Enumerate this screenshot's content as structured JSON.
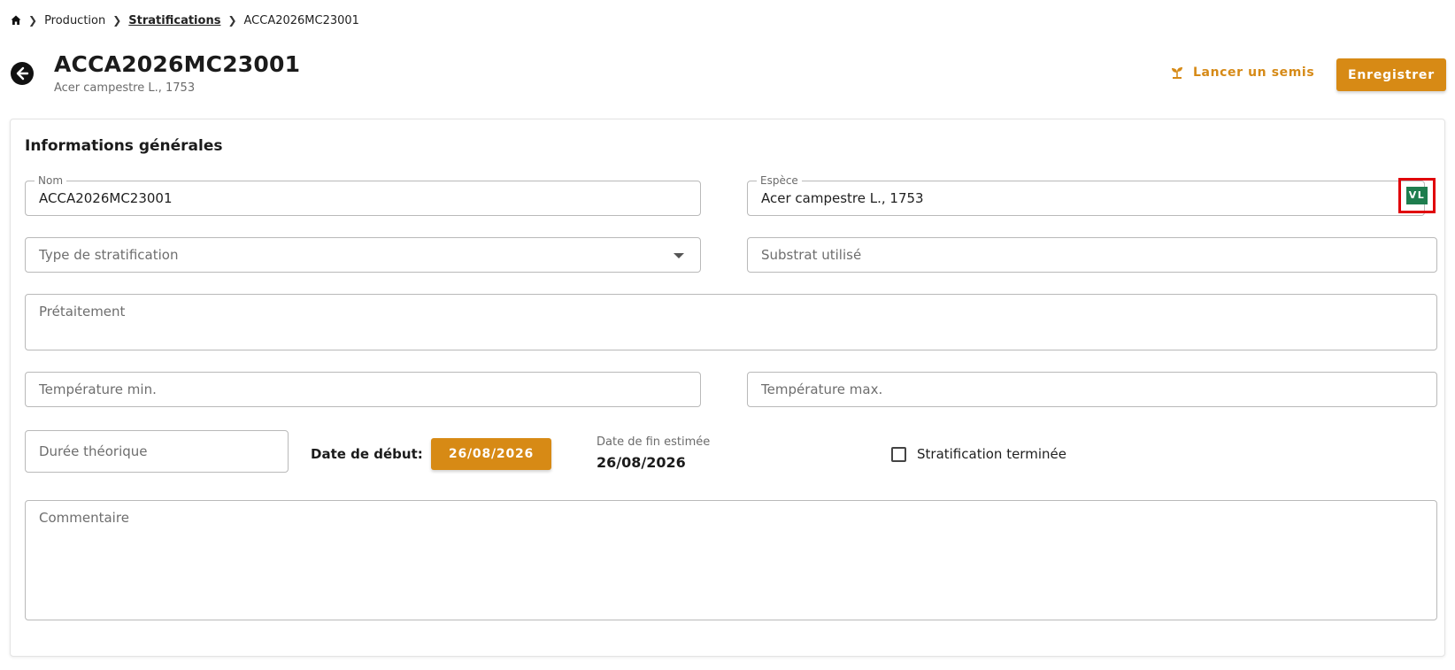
{
  "breadcrumb": {
    "items": [
      "Production",
      "Stratifications",
      "ACCA2026MC23001"
    ]
  },
  "header": {
    "title": "ACCA2026MC23001",
    "subtitle": "Acer campestre L., 1753",
    "secondary_action": "Lancer un semis",
    "primary_action": "Enregistrer"
  },
  "section": {
    "title": "Informations générales"
  },
  "fields": {
    "nom": {
      "label": "Nom",
      "value": "ACCA2026MC23001"
    },
    "espece": {
      "label": "Espèce",
      "value": "Acer campestre L., 1753",
      "badge": "VL"
    },
    "type_stratification": {
      "placeholder": "Type de stratification"
    },
    "substrat": {
      "placeholder": "Substrat utilisé"
    },
    "pretraitement": {
      "placeholder": "Prétaitement"
    },
    "temp_min": {
      "placeholder": "Température min."
    },
    "temp_max": {
      "placeholder": "Température max."
    },
    "duree": {
      "placeholder": "Durée théorique"
    },
    "date_debut": {
      "label": "Date de début:",
      "value": "26/08/2026"
    },
    "date_fin": {
      "label": "Date de fin estimée",
      "value": "26/08/2026"
    },
    "terminee": {
      "label": "Stratification terminée",
      "checked": false
    },
    "commentaire": {
      "placeholder": "Commentaire"
    }
  },
  "colors": {
    "accent": "#d78a15",
    "badge_green": "#1e7d4e",
    "highlight_red": "#e0000a"
  },
  "icons": [
    "home-icon",
    "chevron-right-icon",
    "arrow-left-icon",
    "seedling-icon",
    "chevron-down-icon"
  ]
}
